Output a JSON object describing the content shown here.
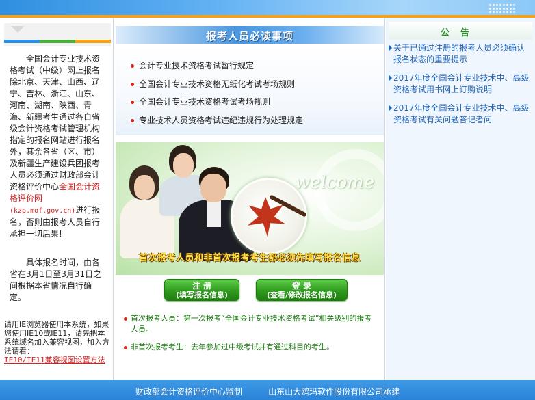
{
  "left": {
    "notice_main": "全国会计专业技术资格考试（中级）网上报名除北京、天津、山西、辽宁、吉林、浙江、山东、河南、湖南、陕西、青海、新疆考生通过各自省级会计资格考试管理机构指定的报名网站进行报名外，其余各省（区、市）及新疆生产建设兵团报考人员必须通过财政部会计资格评价中心",
    "notice_link_name": "全国会计资格评价网",
    "notice_link_url": "(kzp.mof.gov.cn)",
    "notice_end": "进行报名，否则由报考人员自行承担一切后果!",
    "time_text": "具体报名时间，由各省在3月1日至3月31日之间根据本省情况自行确定。",
    "ie_text": "请用IE浏览器使用本系统，如果您使用IE10或IE11，请先把本系统域名加入兼容视图，加入方法请看：",
    "ie_link": "IE10/IE11兼容视图设置方法",
    "bar_colors": [
      "#2f8fe0",
      "#4cae3c",
      "#f3a21a"
    ]
  },
  "center": {
    "header_title": "报考人员必读事项",
    "rules": [
      "会计专业技术资格考试暂行规定",
      "全国会计专业技术资格无纸化考试考场规则",
      "全国会计专业技术资格考试考场规则",
      "专业技术人员资格考试违纪违规行为处理规定"
    ],
    "welcome_word": "welcome",
    "slogan": "首次报考人员和非首次报考考生都必须先填写报名信息",
    "register_button": {
      "line1": "注  册",
      "line2": "(填写报名信息)"
    },
    "login_button": {
      "line1": "登  录",
      "line2": "(查看/修改报名信息)"
    },
    "definitions": [
      "首次报考人员：第一次报考“全国会计专业技术资格考试”相关级别的报考人员。",
      "非首次报考考生：去年参加过中级考试并有通过科目的考生。"
    ]
  },
  "right": {
    "header_title": "公告",
    "announcements": [
      "关于已通过注册的报考人员必须确认报名状态的重要提示",
      "2017年度全国会计专业技术中、高级资格考试用书网上订购说明",
      "2017年度全国会计专业技术中、高级资格考试有关问题答记者问"
    ]
  },
  "footer": {
    "supervisor": "财政部会计资格评价中心监制",
    "developer": "山东山大鸥玛软件股份有限公司承建"
  }
}
